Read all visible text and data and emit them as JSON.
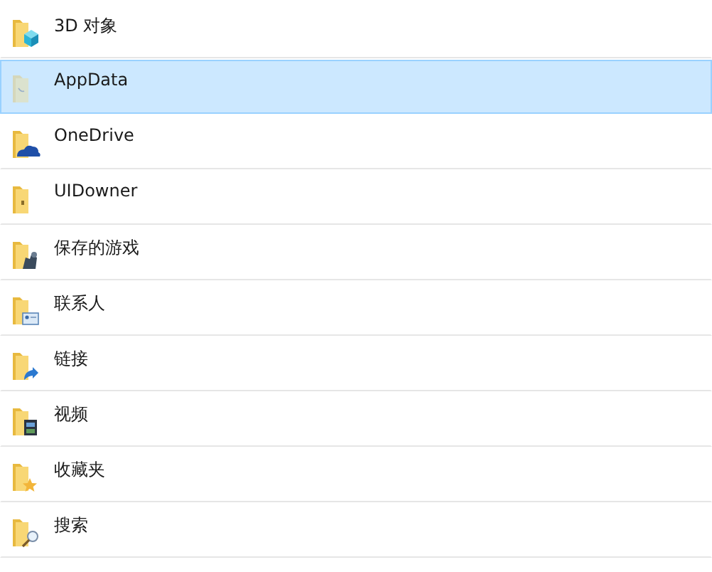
{
  "items": [
    {
      "name": "3D 对象",
      "kind": "objects3d",
      "selected": false
    },
    {
      "name": "AppData",
      "kind": "hidden",
      "selected": true
    },
    {
      "name": "OneDrive",
      "kind": "cloud",
      "selected": false
    },
    {
      "name": "UIDowner",
      "kind": "plain",
      "selected": false
    },
    {
      "name": "保存的游戏",
      "kind": "games",
      "selected": false
    },
    {
      "name": "联系人",
      "kind": "contacts",
      "selected": false
    },
    {
      "name": "链接",
      "kind": "links",
      "selected": false
    },
    {
      "name": "视频",
      "kind": "videos",
      "selected": false
    },
    {
      "name": "收藏夹",
      "kind": "favorites",
      "selected": false
    },
    {
      "name": "搜索",
      "kind": "search",
      "selected": false
    }
  ]
}
